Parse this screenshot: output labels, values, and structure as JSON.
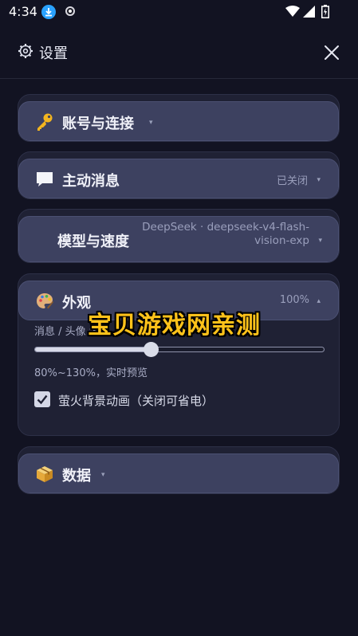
{
  "status_bar": {
    "time": "4:34"
  },
  "header": {
    "title": "设置"
  },
  "sections": {
    "account": {
      "title": "账号与连接",
      "icon": "key-icon",
      "caret": "▾"
    },
    "messages": {
      "title": "主动消息",
      "icon": "speech-bubble-icon",
      "status": "已关闭",
      "caret": "▾"
    },
    "model": {
      "title": "模型与速度",
      "status": "DeepSeek · deepseek-v4-flash-vision-exp",
      "caret": "▾"
    },
    "appearance": {
      "title": "外观",
      "icon": "palette-icon",
      "status": "100%",
      "caret": "▴",
      "slider_label": "消息 / 头像 大小",
      "slider_value_percent": 100,
      "slider_range": [
        80,
        130
      ],
      "hint": "80%~130%，实时预览",
      "checkbox_label": "萤火背景动画（关闭可省电）",
      "checkbox_checked": true
    },
    "data": {
      "title": "数据",
      "icon": "package-icon",
      "caret": "▾"
    }
  },
  "watermark": "宝贝游戏网亲测",
  "colors": {
    "background": "#121322",
    "card": "#1f2134",
    "summary": "#3d4160",
    "watermark": "#ffc21a"
  }
}
